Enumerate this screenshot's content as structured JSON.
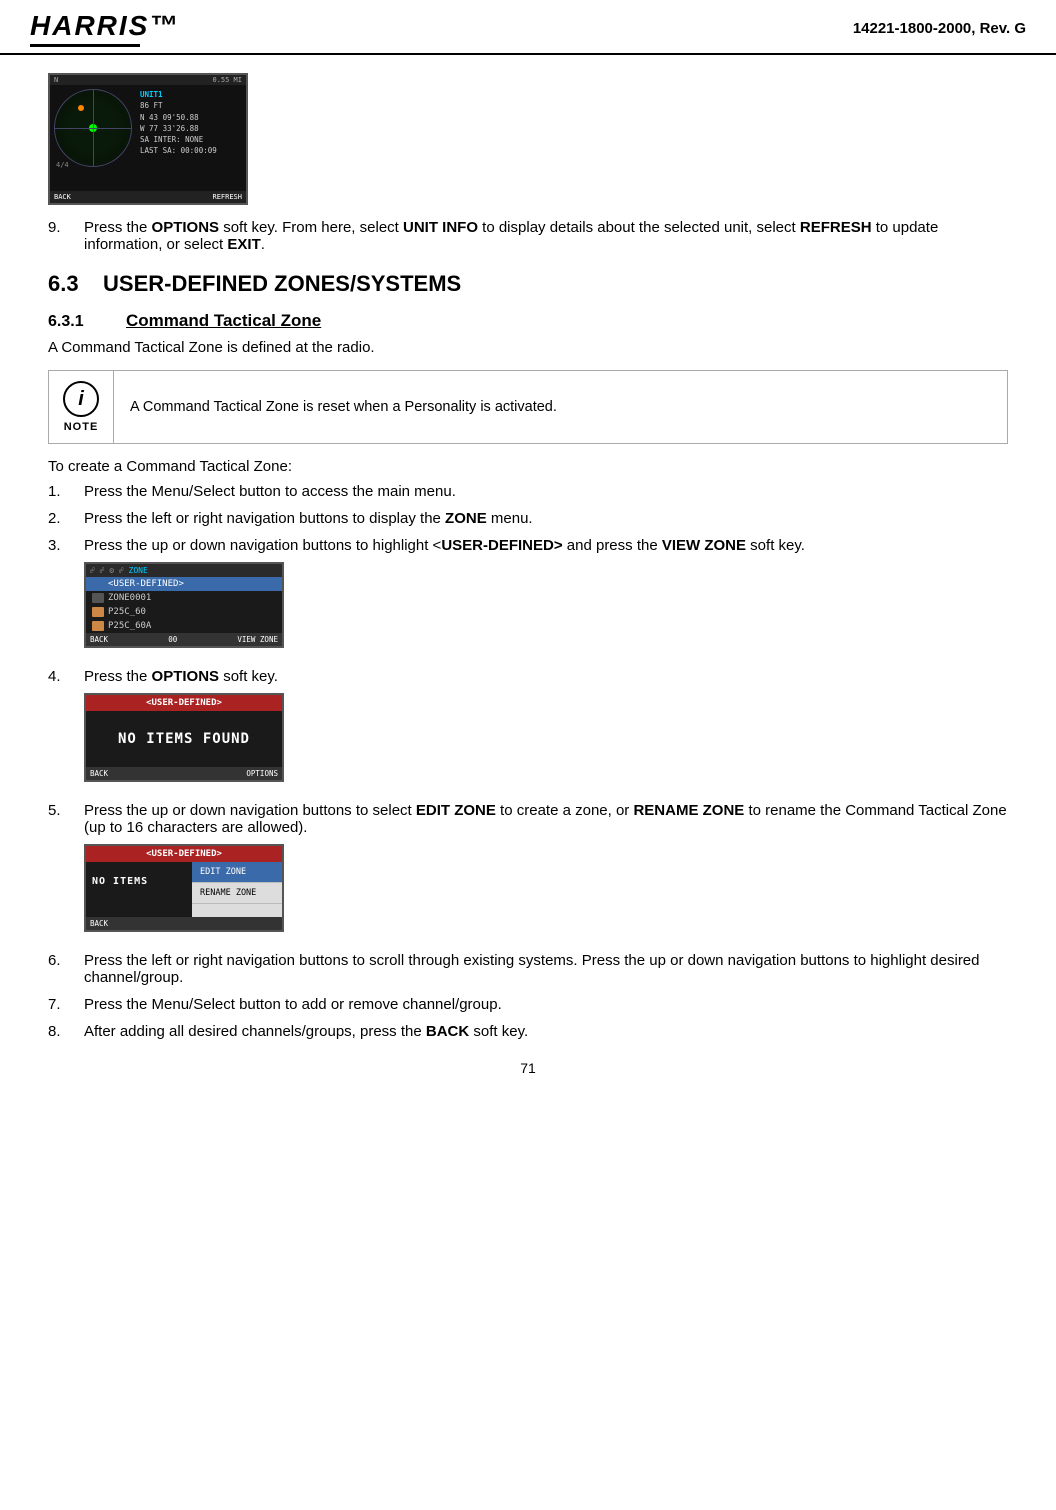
{
  "header": {
    "logo": "HARRIS",
    "doc_number": "14221-1800-2000, Rev. G"
  },
  "step9": {
    "text_start": "Press the ",
    "options_bold": "OPTIONS",
    "text_mid1": " soft key.",
    "text_mid2": " From here, select ",
    "unit_info_bold": "UNIT INFO",
    "text_mid3": " to display details about the selected unit, select ",
    "refresh_bold": "REFRESH",
    "text_mid4": " to update information, or select ",
    "exit_bold": "EXIT",
    "text_end": "."
  },
  "section63": {
    "number": "6.3",
    "title": "USER-DEFINED ZONES/SYSTEMS"
  },
  "section631": {
    "number": "6.3.1",
    "title": "Command Tactical Zone",
    "intro": "A Command Tactical Zone is defined at the radio."
  },
  "note": {
    "label": "NOTE",
    "icon_char": "i",
    "text": "A Command Tactical Zone is reset when a Personality is activated."
  },
  "create_intro": "To create a Command Tactical Zone:",
  "steps": [
    {
      "num": "1.",
      "text": "Press the Menu/Select button to access the main menu."
    },
    {
      "num": "2.",
      "text_start": "Press the left or right navigation buttons to display the ",
      "bold": "ZONE",
      "text_end": " menu."
    },
    {
      "num": "3.",
      "text_start": "Press the up or down navigation buttons to highlight <",
      "bold1": "USER-DEFINED>",
      "text_mid": " and press the ",
      "bold2": "VIEW ZONE",
      "text_end": " soft key."
    },
    {
      "num": "4.",
      "text_start": "Press the ",
      "bold": "OPTIONS",
      "text_end": " soft key."
    },
    {
      "num": "5.",
      "text_start": "Press the up or down navigation buttons to select ",
      "bold1": "EDIT ZONE",
      "text_mid1": " to create a zone, or ",
      "bold2": "RENAME ZONE",
      "text_mid2": " to rename the Command Tactical Zone (up to 16 characters are allowed)."
    },
    {
      "num": "6.",
      "text": "Press the left or right navigation buttons to scroll through existing systems. Press the up or down navigation buttons to highlight desired channel/group."
    },
    {
      "num": "7.",
      "text": "Press the Menu/Select button to add or remove channel/group."
    },
    {
      "num": "8.",
      "text_start": "After adding all desired channels/groups, press the ",
      "bold": "BACK",
      "text_end": " soft key."
    }
  ],
  "screen1": {
    "top_bar": "0.55 MI",
    "unit": "UNIT1",
    "alt": "86 FT",
    "coords": [
      "N 43 09'50.88",
      "W 77 33'26.88"
    ],
    "sa_inter": "SA INTER: NONE",
    "last_sa": "LAST SA: 00:00:09",
    "corner": "N",
    "soft_back": "BACK",
    "soft_refresh": "REFRESH"
  },
  "screen2": {
    "header": "ZONE",
    "rows": [
      {
        "icon": "user-defined",
        "label": "<USER-DEFINED>",
        "selected": true
      },
      {
        "icon": "zone",
        "label": "ZONE0001",
        "selected": false
      },
      {
        "icon": "p25",
        "label": "P25C_60",
        "selected": false
      },
      {
        "icon": "p25",
        "label": "P25C_60A",
        "selected": false
      }
    ],
    "soft_back": "BACK",
    "soft_00": "00",
    "soft_view": "VIEW ZONE"
  },
  "screen3": {
    "header": "<USER-DEFINED>",
    "body": "NO ITEMS FOUND",
    "soft_back": "BACK",
    "soft_options": "OPTIONS"
  },
  "screen4": {
    "header": "<USER-DEFINED>",
    "left_text": "NO ITEMS",
    "menu_items": [
      "EDIT ZONE",
      "RENAME ZONE"
    ],
    "soft_back": "BACK"
  },
  "page_number": "71"
}
